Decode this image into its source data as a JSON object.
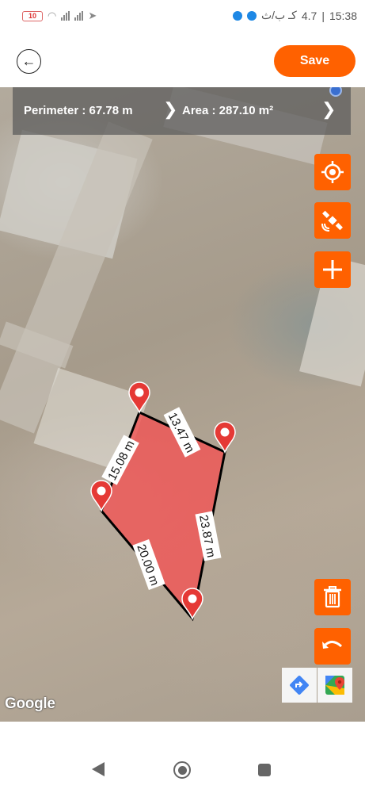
{
  "status_bar": {
    "battery": "10",
    "carrier": "كـ ب/ث",
    "speed": "4.7",
    "time": "15:38"
  },
  "header": {
    "back_icon": "arrow-left-icon",
    "save_label": "Save"
  },
  "measure": {
    "perimeter_text": "Perimeter : 67.78 m",
    "area_text": "Area : 287.10 m²"
  },
  "polygon": {
    "fill_color": "#f05555",
    "edges": [
      {
        "label": "13.47 m"
      },
      {
        "label": "23.87 m"
      },
      {
        "label": "20.00 m"
      },
      {
        "label": "15.08 m"
      }
    ]
  },
  "tools": {
    "locate_icon": "crosshair-target-icon",
    "satellite_icon": "satellite-icon",
    "add_icon": "plus-icon",
    "delete_icon": "trash-icon",
    "undo_icon": "undo-icon",
    "directions_icon": "directions-icon",
    "maps_icon": "google-maps-icon"
  },
  "map": {
    "attribution": "Google"
  },
  "colors": {
    "accent": "#ff6100",
    "pin": "#e53935",
    "pin_outline": "#ffffff"
  }
}
